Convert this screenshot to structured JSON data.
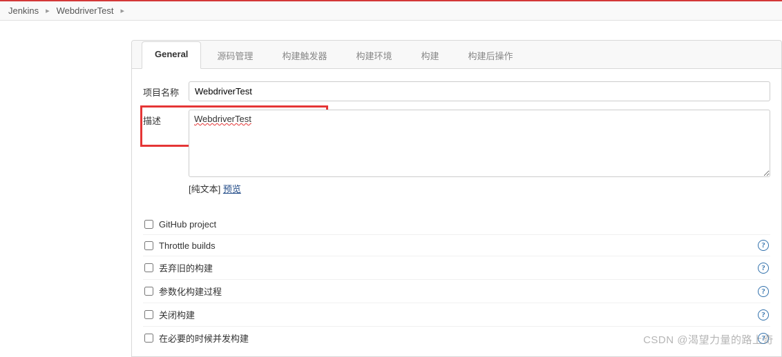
{
  "breadcrumb": {
    "items": [
      {
        "label": "Jenkins"
      },
      {
        "label": "WebdriverTest"
      }
    ]
  },
  "tabs": [
    {
      "label": "General",
      "active": true
    },
    {
      "label": "源码管理",
      "active": false
    },
    {
      "label": "构建触发器",
      "active": false
    },
    {
      "label": "构建环境",
      "active": false
    },
    {
      "label": "构建",
      "active": false
    },
    {
      "label": "构建后操作",
      "active": false
    }
  ],
  "form": {
    "project_name_label": "项目名称",
    "project_name_value": "WebdriverTest",
    "description_label": "描述",
    "description_value": "WebdriverTest",
    "format_prefix": "[纯文本]",
    "format_link": "预览"
  },
  "checkboxes": [
    {
      "label": "GitHub project",
      "help": false
    },
    {
      "label": "Throttle builds",
      "help": true
    },
    {
      "label": "丢弃旧的构建",
      "help": true
    },
    {
      "label": "参数化构建过程",
      "help": true
    },
    {
      "label": "关闭构建",
      "help": true
    },
    {
      "label": "在必要的时候并发构建",
      "help": true
    }
  ],
  "watermark": "CSDN @渴望力量的路上奇"
}
